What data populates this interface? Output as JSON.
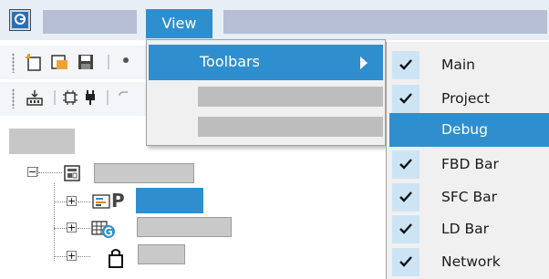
{
  "menubar": {
    "view_label": "View"
  },
  "view_menu": {
    "toolbars_label": "Toolbars"
  },
  "toolbars_submenu": {
    "items": [
      {
        "label": "Main",
        "checked": true
      },
      {
        "label": "Project",
        "checked": true
      },
      {
        "label": "Debug",
        "checked": false,
        "highlighted": true
      },
      {
        "label": "FBD Bar",
        "checked": true
      },
      {
        "label": "SFC Bar",
        "checked": true
      },
      {
        "label": "LD Bar",
        "checked": true
      },
      {
        "label": "Network",
        "checked": true
      }
    ]
  },
  "tree": {
    "expand_symbol": "−",
    "collapsed_symbol": "+",
    "p_icon_letter": "P"
  },
  "colors": {
    "accent": "#2f8fce",
    "menubar_bg": "#e8eef6",
    "check_bg": "#cde4f4",
    "menu_bg": "#f0f0f0"
  }
}
